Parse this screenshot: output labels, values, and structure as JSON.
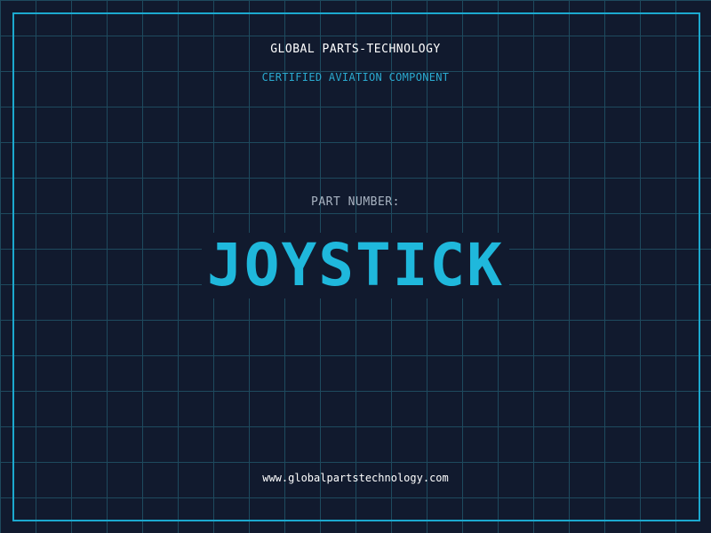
{
  "header": {
    "company": "GLOBAL PARTS-TECHNOLOGY",
    "tagline": "CERTIFIED AVIATION COMPONENT"
  },
  "part": {
    "label": "PART NUMBER:",
    "value": "JOYSTICK"
  },
  "footer": {
    "website": "www.globalpartstechnology.com"
  },
  "colors": {
    "background": "#111a2e",
    "grid": "#1e4a5e",
    "accent": "#1fb8dc",
    "frame": "#1ca9cf",
    "text": "#ffffff",
    "muted": "#a9b4c2"
  }
}
